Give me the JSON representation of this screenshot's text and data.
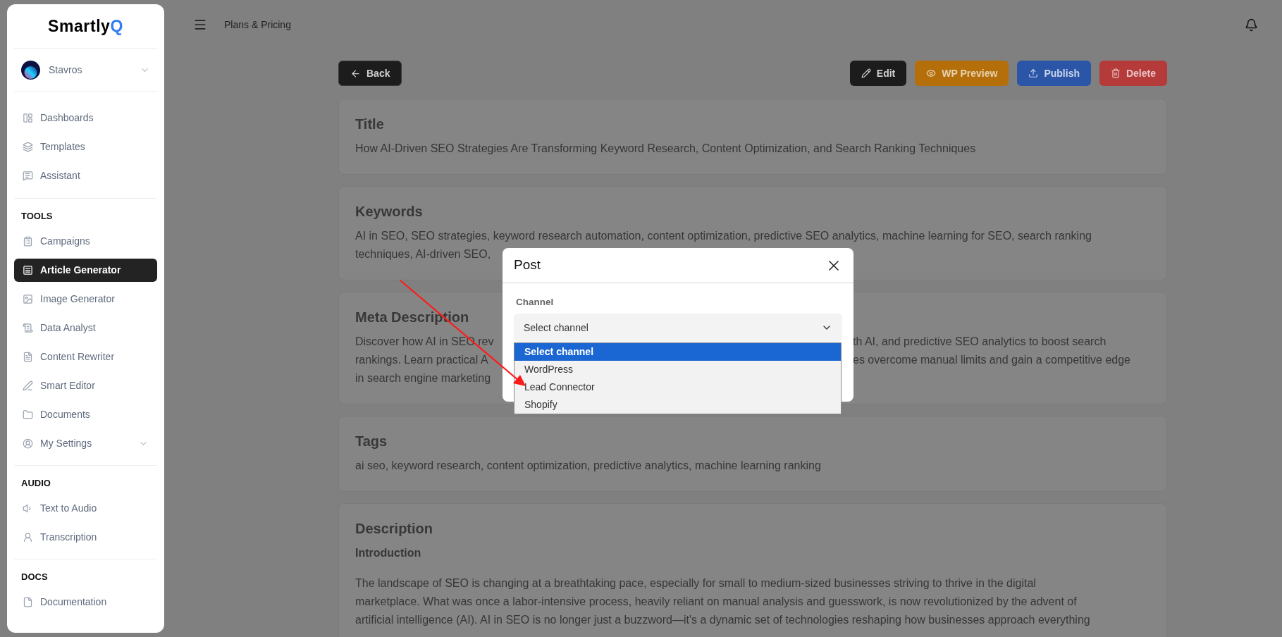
{
  "sidebar": {
    "logo": {
      "text": "Smartly",
      "accent": "Q"
    },
    "profile": {
      "name": "Stavros"
    },
    "sections": [
      {
        "items": [
          {
            "label": "Dashboards",
            "selected": false
          },
          {
            "label": "Templates",
            "selected": false
          },
          {
            "label": "Assistant",
            "selected": false
          }
        ]
      },
      {
        "heading": "TOOLS",
        "items": [
          {
            "label": "Campaigns",
            "selected": false
          },
          {
            "label": "Article Generator",
            "selected": true
          },
          {
            "label": "Image Generator",
            "selected": false
          },
          {
            "label": "Data Analyst",
            "selected": false
          },
          {
            "label": "Content Rewriter",
            "selected": false
          },
          {
            "label": "Smart Editor",
            "selected": false
          },
          {
            "label": "Documents",
            "selected": false
          },
          {
            "label": "My Settings",
            "selected": false,
            "expandable": true
          }
        ]
      },
      {
        "heading": "AUDIO",
        "items": [
          {
            "label": "Text to Audio",
            "selected": false
          },
          {
            "label": "Transcription",
            "selected": false
          }
        ]
      },
      {
        "heading": "DOCS",
        "items": [
          {
            "label": "Documentation",
            "selected": false
          }
        ]
      }
    ]
  },
  "topbar": {
    "link": "Plans & Pricing"
  },
  "back_button": "Back",
  "actions": [
    {
      "kind": "edit",
      "label": "Edit"
    },
    {
      "kind": "preview",
      "label": "WP Preview"
    },
    {
      "kind": "publish",
      "label": "Publish"
    },
    {
      "kind": "delete",
      "label": "Delete"
    }
  ],
  "cards": [
    {
      "heading": "Title",
      "lines": [
        {
          "left": "How AI-Driven SEO Strategies Are Transforming Keyword Research, Content Optimization, and Search Ranking Techniques"
        }
      ]
    },
    {
      "heading": "Keywords",
      "lines": [
        {
          "left": "AI in SEO, SEO strategies, keyword research automation, content optimization, predictive SEO analytics, machine learning for SEO, search ranking"
        },
        {
          "left": "techniques, AI-driven SEO,"
        }
      ]
    },
    {
      "heading": "Meta Description",
      "lines": [
        {
          "left": "Discover how AI in SEO rev",
          "right": "th AI, and predictive SEO analytics to boost search"
        },
        {
          "left": "rankings. Learn practical A",
          "right": "es overcome manual limits and gain a competitive edge"
        },
        {
          "left": "in search engine marketing"
        }
      ]
    },
    {
      "heading": "Tags",
      "lines": [
        {
          "left": "ai seo, keyword research, content optimization, predictive analytics, machine learning ranking"
        }
      ]
    },
    {
      "heading": "Description",
      "subheading": "Introduction",
      "paragraph": [
        "The landscape of SEO is changing at a breathtaking pace, especially for small to medium-sized businesses striving to thrive in the digital",
        "marketplace. What was once a labor-intensive process, heavily reliant on manual analysis and guesswork, is now revolutionized by the advent of",
        "artificial intelligence (AI). AI in SEO is no longer just a buzzword—it's a dynamic set of technologies reshaping how businesses approach everything"
      ]
    }
  ],
  "modal": {
    "title": "Post",
    "field_label": "Channel",
    "select_value": "Select channel",
    "options": [
      {
        "label": "Select channel",
        "selected": true
      },
      {
        "label": "WordPress",
        "selected": false
      },
      {
        "label": "Lead Connector",
        "selected": false
      },
      {
        "label": "Shopify",
        "selected": false
      }
    ]
  }
}
